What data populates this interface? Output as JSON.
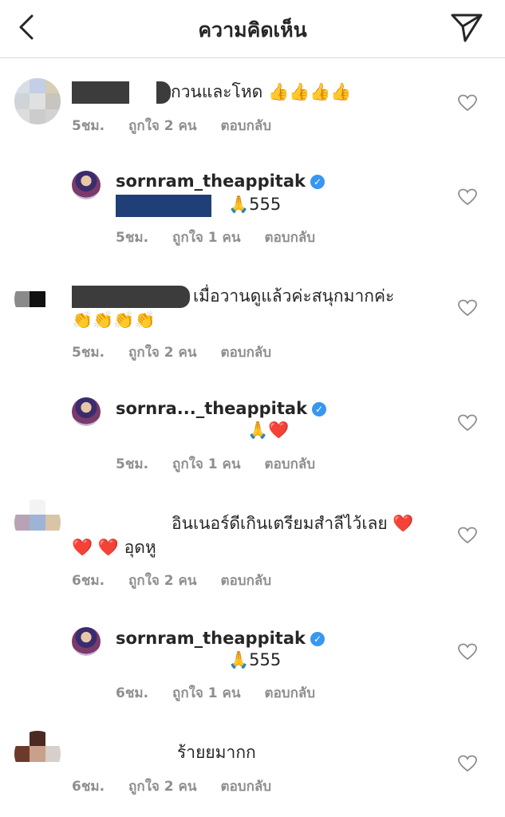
{
  "header": {
    "title": "ความคิดเห็น"
  },
  "comments": [
    {
      "text": "กวนและโหด 👍👍👍👍",
      "time": "5ชม.",
      "likes": "ถูกใจ 2 คน",
      "reply": "ตอบกลับ"
    },
    {
      "username": "sornram_theappitak",
      "text": "🙏555",
      "time": "5ชม.",
      "likes": "ถูกใจ 1 คน",
      "reply": "ตอบกลับ"
    },
    {
      "text": "เมื่อวานดูแล้วค่ะสนุกมากค่ะ",
      "text2": "👏👏👏👏",
      "time": "5ชม.",
      "likes": "ถูกใจ 2 คน",
      "reply": "ตอบกลับ"
    },
    {
      "username": "sornra..._theappitak",
      "text": "🙏❤️",
      "time": "5ชม.",
      "likes": "ถูกใจ 1 คน",
      "reply": "ตอบกลับ"
    },
    {
      "text": "อินเนอร์ดีเกินเตรียมสำลีไว้เลย ❤️",
      "text2": "❤️ ❤️ อุดหู",
      "time": "6ชม.",
      "likes": "ถูกใจ 2 คน",
      "reply": "ตอบกลับ"
    },
    {
      "username": "sornram_theappitak",
      "text": "🙏555",
      "time": "6ชม.",
      "likes": "ถูกใจ 1 คน",
      "reply": "ตอบกลับ"
    },
    {
      "text": "ร้ายยมากก",
      "time": "6ชม.",
      "likes": "ถูกใจ 2 คน",
      "reply": "ตอบกลับ"
    }
  ]
}
